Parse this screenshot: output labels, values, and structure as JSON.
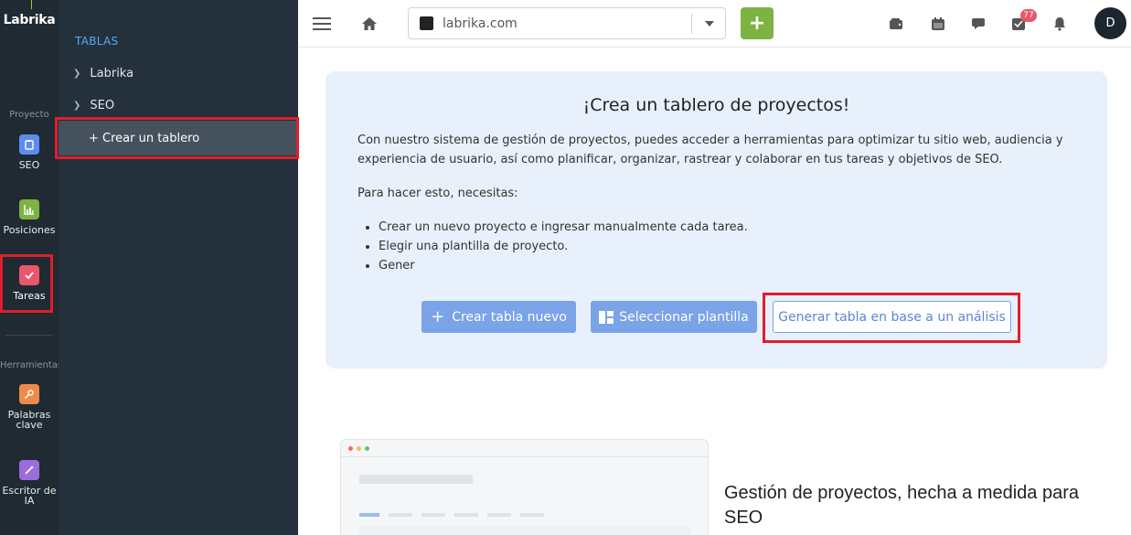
{
  "app": {
    "logo": "Labrika"
  },
  "rail": {
    "section_project": "Proyecto",
    "section_tools": "Herramientas",
    "items": [
      {
        "label": "SEO",
        "icon": "clipboard-icon",
        "color": "#5b8def"
      },
      {
        "label": "Posiciones",
        "icon": "chart-icon",
        "color": "#7cb342"
      },
      {
        "label": "Tareas",
        "icon": "check-icon",
        "color": "#e9576b"
      },
      {
        "label": "Palabras clave",
        "icon": "key-icon",
        "color": "#f08a4b"
      },
      {
        "label": "Escritor de IA",
        "icon": "magic-wand-icon",
        "color": "#9b6ddc"
      }
    ]
  },
  "sidebar": {
    "title": "TABLAS",
    "items": [
      {
        "label": "Labrika"
      },
      {
        "label": "SEO"
      }
    ],
    "create_label": "+ Crear un tablero"
  },
  "topbar": {
    "site": "labrika.com",
    "add_label": "+",
    "badge_count": "77",
    "avatar": "D",
    "icons": [
      "menu-icon",
      "home-icon",
      "wallet-icon",
      "calendar-icon",
      "chat-icon",
      "tasks-icon",
      "bell-icon"
    ]
  },
  "card": {
    "title": "¡Crea un tablero de proyectos!",
    "intro": "Con nuestro sistema de gestión de proyectos, puedes acceder a herramientas para optimizar tu sitio web, audiencia y experiencia de usuario, así como planificar, organizar, rastrear y colaborar en tus tareas y objetivos de SEO.",
    "need": "Para hacer esto, necesitas:",
    "list": [
      "Crear un nuevo proyecto e ingresar manualmente cada tarea.",
      "Elegir una plantilla de proyecto.",
      "Gener"
    ],
    "btn_new": "Crear tabla nuevo",
    "btn_template": "Seleccionar plantilla",
    "btn_generate": "Generar tabla en base a un análisis"
  },
  "promo": {
    "title": "Gestión de proyectos, hecha a medida para SEO"
  },
  "colors": {
    "accent_green": "#7cb342",
    "accent_blue": "#7aa3e8",
    "highlight_red": "#e11d2b"
  }
}
